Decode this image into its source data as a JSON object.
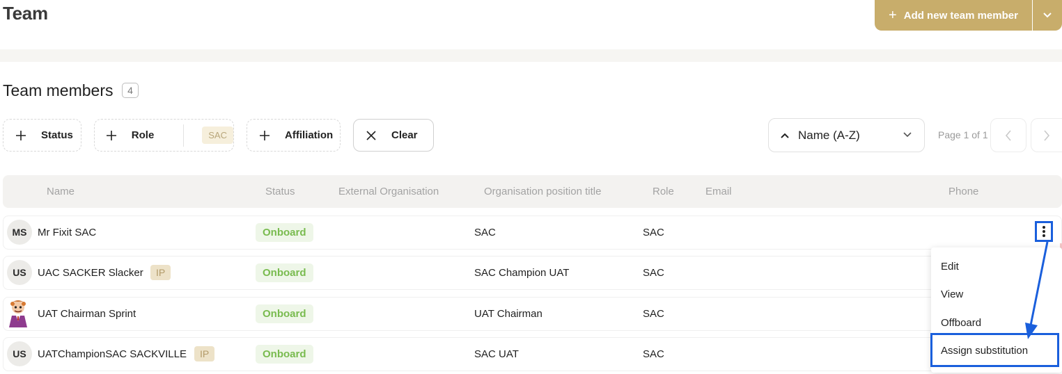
{
  "header": {
    "title": "Team",
    "add_button_label": "Add new team member"
  },
  "section": {
    "title": "Team members",
    "count": "4"
  },
  "filters": {
    "status_label": "Status",
    "role_label": "Role",
    "role_selected": "SAC",
    "affiliation_label": "Affiliation",
    "clear_label": "Clear"
  },
  "sort": {
    "selected": "Name (A-Z)"
  },
  "pagination": {
    "text": "Page 1 of 1"
  },
  "table": {
    "columns": [
      "Name",
      "Status",
      "External Organisation",
      "Organisation position title",
      "Role",
      "Email",
      "Phone"
    ],
    "rows": [
      {
        "initials": "MS",
        "name": "Mr Fixit SAC",
        "tag": "",
        "status": "Onboard",
        "external_org": "",
        "position": "SAC",
        "role": "SAC",
        "email": "",
        "phone": ""
      },
      {
        "initials": "US",
        "name": "UAC SACKER Slacker",
        "tag": "IP",
        "status": "Onboard",
        "external_org": "",
        "position": "SAC Champion UAT",
        "role": "SAC",
        "email": "",
        "phone": ""
      },
      {
        "initials": "",
        "name": "UAT Chairman Sprint",
        "tag": "",
        "status": "Onboard",
        "external_org": "",
        "position": "UAT Chairman",
        "role": "SAC",
        "email": "",
        "phone": ""
      },
      {
        "initials": "US",
        "name": "UATChampionSAC SACKVILLE",
        "tag": "IP",
        "status": "Onboard",
        "external_org": "",
        "position": "SAC UAT",
        "role": "SAC",
        "email": "",
        "phone": ""
      }
    ]
  },
  "row_menu": {
    "items": [
      "Edit",
      "View",
      "Offboard",
      "Assign substitution"
    ]
  },
  "colors": {
    "accent": "#c8ad6b",
    "status_green": "#79bb4f",
    "highlight_blue": "#1a5fdc"
  }
}
